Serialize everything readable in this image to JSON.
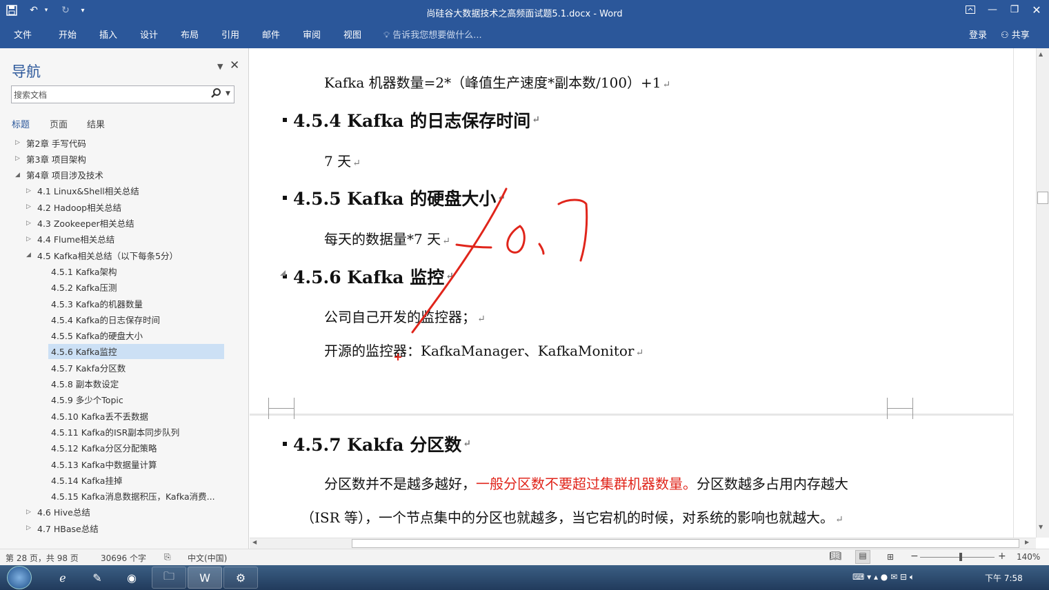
{
  "title_bar": {
    "document_title": "尚硅谷大数据技术之高频面试题5.1.docx - Word",
    "save_icon": "save-icon",
    "undo_icon": "undo-icon",
    "redo_icon": "redo-icon",
    "customize_icon": "customize-qat-icon"
  },
  "ribbon": {
    "tabs": [
      "文件",
      "开始",
      "插入",
      "设计",
      "布局",
      "引用",
      "邮件",
      "审阅",
      "视图"
    ],
    "tell_me": "告诉我您想要做什么...",
    "login": "登录",
    "share": "共享"
  },
  "nav": {
    "title": "导航",
    "search_placeholder": "搜索文档",
    "tabs": [
      "标题",
      "页面",
      "结果"
    ],
    "items": [
      {
        "label": "第2章 手写代码",
        "level": 0,
        "expand": "collapsed"
      },
      {
        "label": "第3章 项目架构",
        "level": 0,
        "expand": "collapsed"
      },
      {
        "label": "第4章 项目涉及技术",
        "level": 0,
        "expand": "expanded"
      },
      {
        "label": "4.1 Linux&Shell相关总结",
        "level": 1,
        "expand": "collapsed"
      },
      {
        "label": "4.2 Hadoop相关总结",
        "level": 1,
        "expand": "collapsed"
      },
      {
        "label": "4.3 Zookeeper相关总结",
        "level": 1,
        "expand": "collapsed"
      },
      {
        "label": "4.4 Flume相关总结",
        "level": 1,
        "expand": "collapsed"
      },
      {
        "label": "4.5 Kafka相关总结（以下每条5分）",
        "level": 1,
        "expand": "expanded"
      },
      {
        "label": "4.5.1 Kafka架构",
        "level": 2,
        "expand": "none"
      },
      {
        "label": "4.5.2 Kafka压测",
        "level": 2,
        "expand": "none"
      },
      {
        "label": "4.5.3 Kafka的机器数量",
        "level": 2,
        "expand": "none"
      },
      {
        "label": "4.5.4 Kafka的日志保存时间",
        "level": 2,
        "expand": "none"
      },
      {
        "label": "4.5.5 Kafka的硬盘大小",
        "level": 2,
        "expand": "none"
      },
      {
        "label": "4.5.6 Kafka监控",
        "level": 2,
        "expand": "none",
        "selected": true
      },
      {
        "label": "4.5.7 Kakfa分区数",
        "level": 2,
        "expand": "none"
      },
      {
        "label": "4.5.8 副本数设定",
        "level": 2,
        "expand": "none"
      },
      {
        "label": "4.5.9 多少个Topic",
        "level": 2,
        "expand": "none"
      },
      {
        "label": "4.5.10 Kafka丢不丢数据",
        "level": 2,
        "expand": "none"
      },
      {
        "label": "4.5.11 Kafka的ISR副本同步队列",
        "level": 2,
        "expand": "none"
      },
      {
        "label": "4.5.12 Kafka分区分配策略",
        "level": 2,
        "expand": "none"
      },
      {
        "label": "4.5.13 Kafka中数据量计算",
        "level": 2,
        "expand": "none"
      },
      {
        "label": "4.5.14 Kafka挂掉",
        "level": 2,
        "expand": "none"
      },
      {
        "label": "4.5.15 Kafka消息数据积压，Kafka消费...",
        "level": 2,
        "expand": "none"
      },
      {
        "label": "4.6 Hive总结",
        "level": 1,
        "expand": "collapsed"
      },
      {
        "label": "4.7 HBase总结",
        "level": 1,
        "expand": "collapsed"
      }
    ]
  },
  "document": {
    "p_machines": "Kafka 机器数量=2*（峰值生产速度*副本数/100）+1",
    "h_454": "4.5.4 Kafka 的日志保存时间",
    "p_7days": "7 天",
    "h_455": "4.5.5 Kafka 的硬盘大小",
    "p_disk": "每天的数据量*7 天",
    "h_456": "4.5.6 Kafka 监控",
    "p_monitor1": "公司自己开发的监控器；",
    "p_monitor2": "开源的监控器：KafkaManager、KafkaMonitor",
    "h_457": "4.5.7 Kakfa 分区数",
    "p_part_a": "分区数并不是越多越好，",
    "p_part_red": "一般分区数不要超过集群机器数量。",
    "p_part_b": "分区数越多占用内存越大",
    "p_part2": "（ISR 等），一个节点集中的分区也就越多，当它宕机的时候，对系统的影响也就越大。",
    "para_mark": "↵",
    "ink_color": "#e0251b"
  },
  "status": {
    "page": "第 28 页，共 98 页",
    "words": "30696 个字",
    "lang": "中文(中国)",
    "zoom": "140%",
    "zoom_minus": "−",
    "zoom_plus": "+"
  },
  "taskbar": {
    "time": "下午 7:58"
  }
}
